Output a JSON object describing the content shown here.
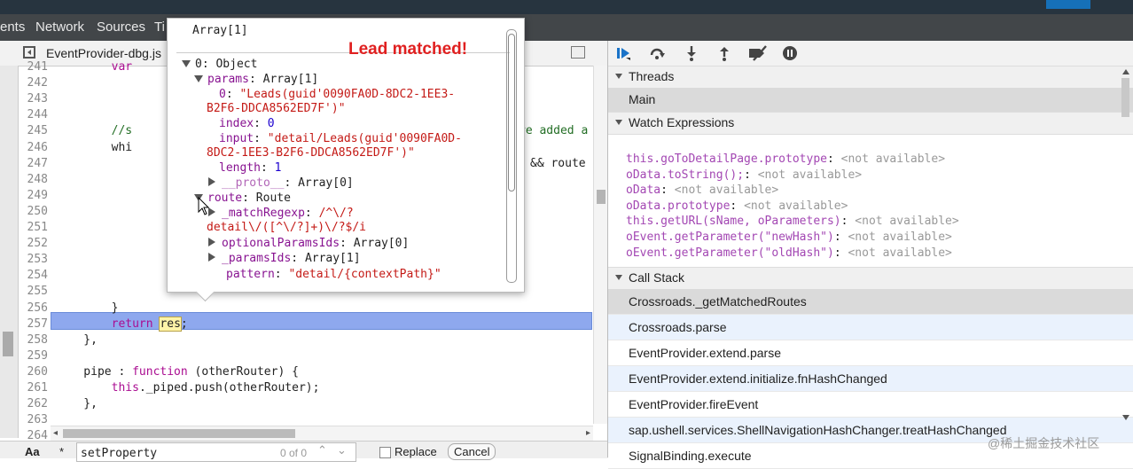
{
  "tabs": [
    "ents",
    "Network",
    "Sources",
    "Ti"
  ],
  "source": {
    "file": "EventProvider-dbg.js",
    "lines": [
      {
        "n": "241",
        "text": "        var"
      },
      {
        "n": "242",
        "text": ""
      },
      {
        "n": "243",
        "text": ""
      },
      {
        "n": "244",
        "text": ""
      },
      {
        "n": "245",
        "text": "        //s",
        "tail": "re added a"
      },
      {
        "n": "246",
        "text": "        whi"
      },
      {
        "n": "247",
        "text": "",
        "tail": "&& route"
      },
      {
        "n": "248",
        "text": ""
      },
      {
        "n": "249",
        "text": ""
      },
      {
        "n": "250",
        "text": ""
      },
      {
        "n": "251",
        "text": ""
      },
      {
        "n": "252",
        "text": ""
      },
      {
        "n": "253",
        "text": ""
      },
      {
        "n": "254",
        "text": ""
      },
      {
        "n": "255",
        "text": ""
      },
      {
        "n": "256",
        "text": "        }"
      },
      {
        "n": "257",
        "text": "        return res;"
      },
      {
        "n": "258",
        "text": "    },"
      },
      {
        "n": "259",
        "text": ""
      },
      {
        "n": "260",
        "text": "    pipe : function (otherRouter) {"
      },
      {
        "n": "261",
        "text": "        this._piped.push(otherRouter);"
      },
      {
        "n": "262",
        "text": "    },"
      },
      {
        "n": "263",
        "text": ""
      },
      {
        "n": "264",
        "text": ""
      }
    ]
  },
  "find": {
    "case_label": "Aa",
    "regex_label": "*",
    "query": "setProperty",
    "count": "0 of 0",
    "replace_label": "Replace",
    "cancel_label": "Cancel"
  },
  "popover": {
    "title": "Array[1]",
    "annotation": "Lead matched!",
    "rows": [
      {
        "label": "0: Object"
      },
      {
        "key": "params",
        "val": "Array[1]"
      },
      {
        "key": "0",
        "val": "\"Leads(guid'0090FA0D-8DC2-1EE3-"
      },
      {
        "val": "B2F6-DDCA8562ED7F')\""
      },
      {
        "key": "index",
        "val": "0"
      },
      {
        "key": "input",
        "val": "\"detail/Leads(guid'0090FA0D-"
      },
      {
        "val": "8DC2-1EE3-B2F6-DDCA8562ED7F')\""
      },
      {
        "key": "length",
        "val": "1"
      },
      {
        "key": "__proto__",
        "val": "Array[0]"
      },
      {
        "key": "route",
        "val": "Route"
      },
      {
        "key": "_matchRegexp",
        "val": "/^\\/?"
      },
      {
        "val": "detail\\/([^\\/?]+)\\/?$/i"
      },
      {
        "key": "optionalParamsIds",
        "val": "Array[0]"
      },
      {
        "key": "_paramsIds",
        "val": "Array[1]"
      },
      {
        "key": "pattern",
        "val": "\"detail/{contextPath}\""
      }
    ]
  },
  "debugger": {
    "threads_label": "Threads",
    "thread_main": "Main",
    "watch_label": "Watch Expressions",
    "watch": [
      {
        "expr": "this.goToDetailPage.prototype",
        "value": "<not available>"
      },
      {
        "expr": "oData.toString();",
        "value": "<not available>"
      },
      {
        "expr": "oData",
        "value": "<not available>"
      },
      {
        "expr": "oData.prototype",
        "value": "<not available>"
      },
      {
        "expr": "this.getURL(sName, oParameters)",
        "value": "<not available>"
      },
      {
        "expr": "oEvent.getParameter(\"newHash\")",
        "value": "<not available>"
      },
      {
        "expr": "oEvent.getParameter(\"oldHash\")",
        "value": "<not available>"
      }
    ],
    "callstack_label": "Call Stack",
    "frames": [
      "Crossroads._getMatchedRoutes",
      "Crossroads.parse",
      "EventProvider.extend.parse",
      "EventProvider.extend.initialize.fnHashChanged",
      "EventProvider.fireEvent",
      "sap.ushell.services.ShellNavigationHashChanger.treatHashChanged",
      "SignalBinding.execute"
    ]
  },
  "watermark": "@稀土掘金技术社区",
  "colors": {
    "keyword": "#aa0d91",
    "comment": "#236e25",
    "highlight": "#8ea8ee",
    "annotation": "#e02020"
  }
}
